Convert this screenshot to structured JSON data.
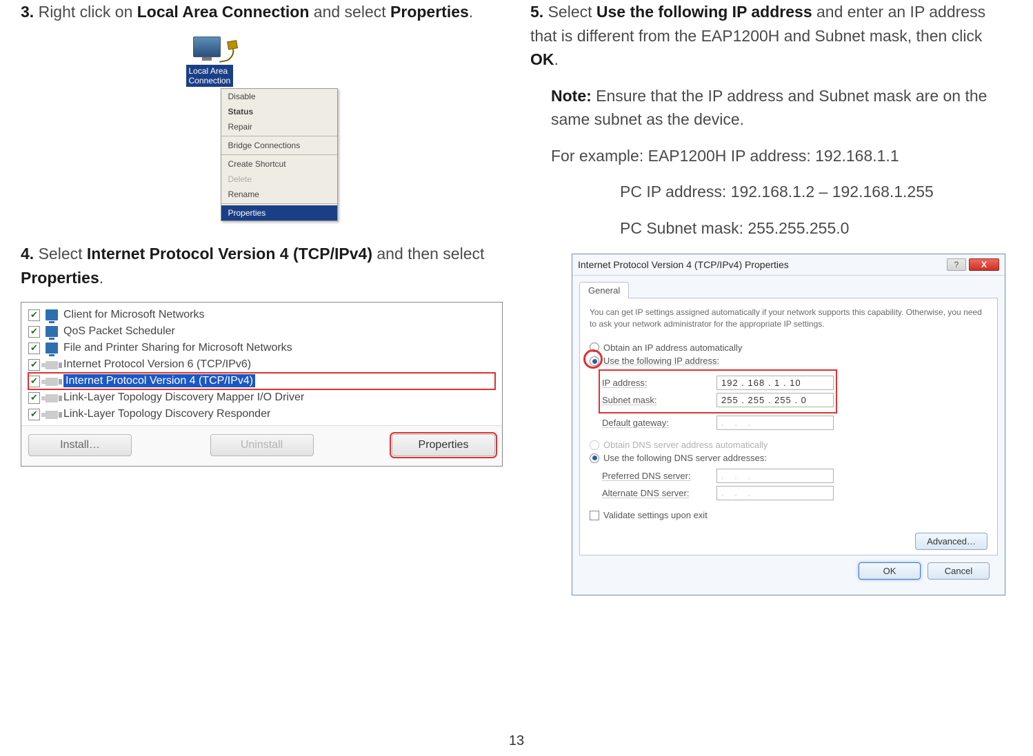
{
  "page_number": "13",
  "step3": {
    "num": "3.",
    "pre": "Right click on ",
    "b1": "Local Area Connection",
    "mid": " and select ",
    "b2": "Properties",
    "post": "."
  },
  "lac_label_line1": "Local Area",
  "lac_label_line2": "Connection",
  "ctx": {
    "disable": "Disable",
    "status": "Status",
    "repair": "Repair",
    "bridge": "Bridge Connections",
    "shortcut": "Create Shortcut",
    "delete": "Delete",
    "rename": "Rename",
    "properties": "Properties"
  },
  "step4": {
    "num": "4.",
    "pre": "Select ",
    "b1": "Internet Protocol Version 4 (TCP/IPv4)",
    "mid": " and then select ",
    "b2": "Properties",
    "post": "."
  },
  "conn_items": {
    "i1": "Client for Microsoft Networks",
    "i2": "QoS Packet Scheduler",
    "i3": "File and Printer Sharing for Microsoft Networks",
    "i4": "Internet Protocol Version 6 (TCP/IPv6)",
    "i5": "Internet Protocol Version 4 (TCP/IPv4)",
    "i6": "Link-Layer Topology Discovery Mapper I/O Driver",
    "i7": "Link-Layer Topology Discovery Responder"
  },
  "conn_buttons": {
    "install": "Install…",
    "uninstall": "Uninstall",
    "properties": "Properties"
  },
  "step5": {
    "num": "5.",
    "pre": "Select ",
    "b1": "Use the following IP address",
    "mid": " and enter an IP address that is different from the EAP1200H and Subnet mask, then click ",
    "b2": "OK",
    "post": "."
  },
  "note_label": "Note:",
  "note_text": " Ensure that the IP address and Subnet mask are on the same subnet as the device.",
  "example_line": "For example: EAP1200H IP address: 192.168.1.1",
  "pc_ip_line": "PC IP address: 192.168.1.2 – 192.168.1.255",
  "pc_subnet_line": "PC Subnet mask: 255.255.255.0",
  "dlg": {
    "title": "Internet Protocol Version 4 (TCP/IPv4) Properties",
    "help": "?",
    "close": "X",
    "tab": "General",
    "desc": "You can get IP settings assigned automatically if your network supports this capability. Otherwise, you need to ask your network administrator for the appropriate IP settings.",
    "r_auto_ip": "Obtain an IP address automatically",
    "r_use_ip": "Use the following IP address:",
    "lbl_ip": "IP address:",
    "val_ip": "192 . 168 .   1  .  10",
    "lbl_mask": "Subnet mask:",
    "val_mask": "255 . 255 . 255 .   0",
    "lbl_gw": "Default gateway:",
    "val_gw": ".       .       .",
    "r_auto_dns": "Obtain DNS server address automatically",
    "r_use_dns": "Use the following DNS server addresses:",
    "lbl_pdns": "Preferred DNS server:",
    "lbl_adns": "Alternate DNS server:",
    "val_dns": ".       .       .",
    "chk_validate": "Validate settings upon exit",
    "advanced": "Advanced…",
    "ok": "OK",
    "cancel": "Cancel"
  }
}
